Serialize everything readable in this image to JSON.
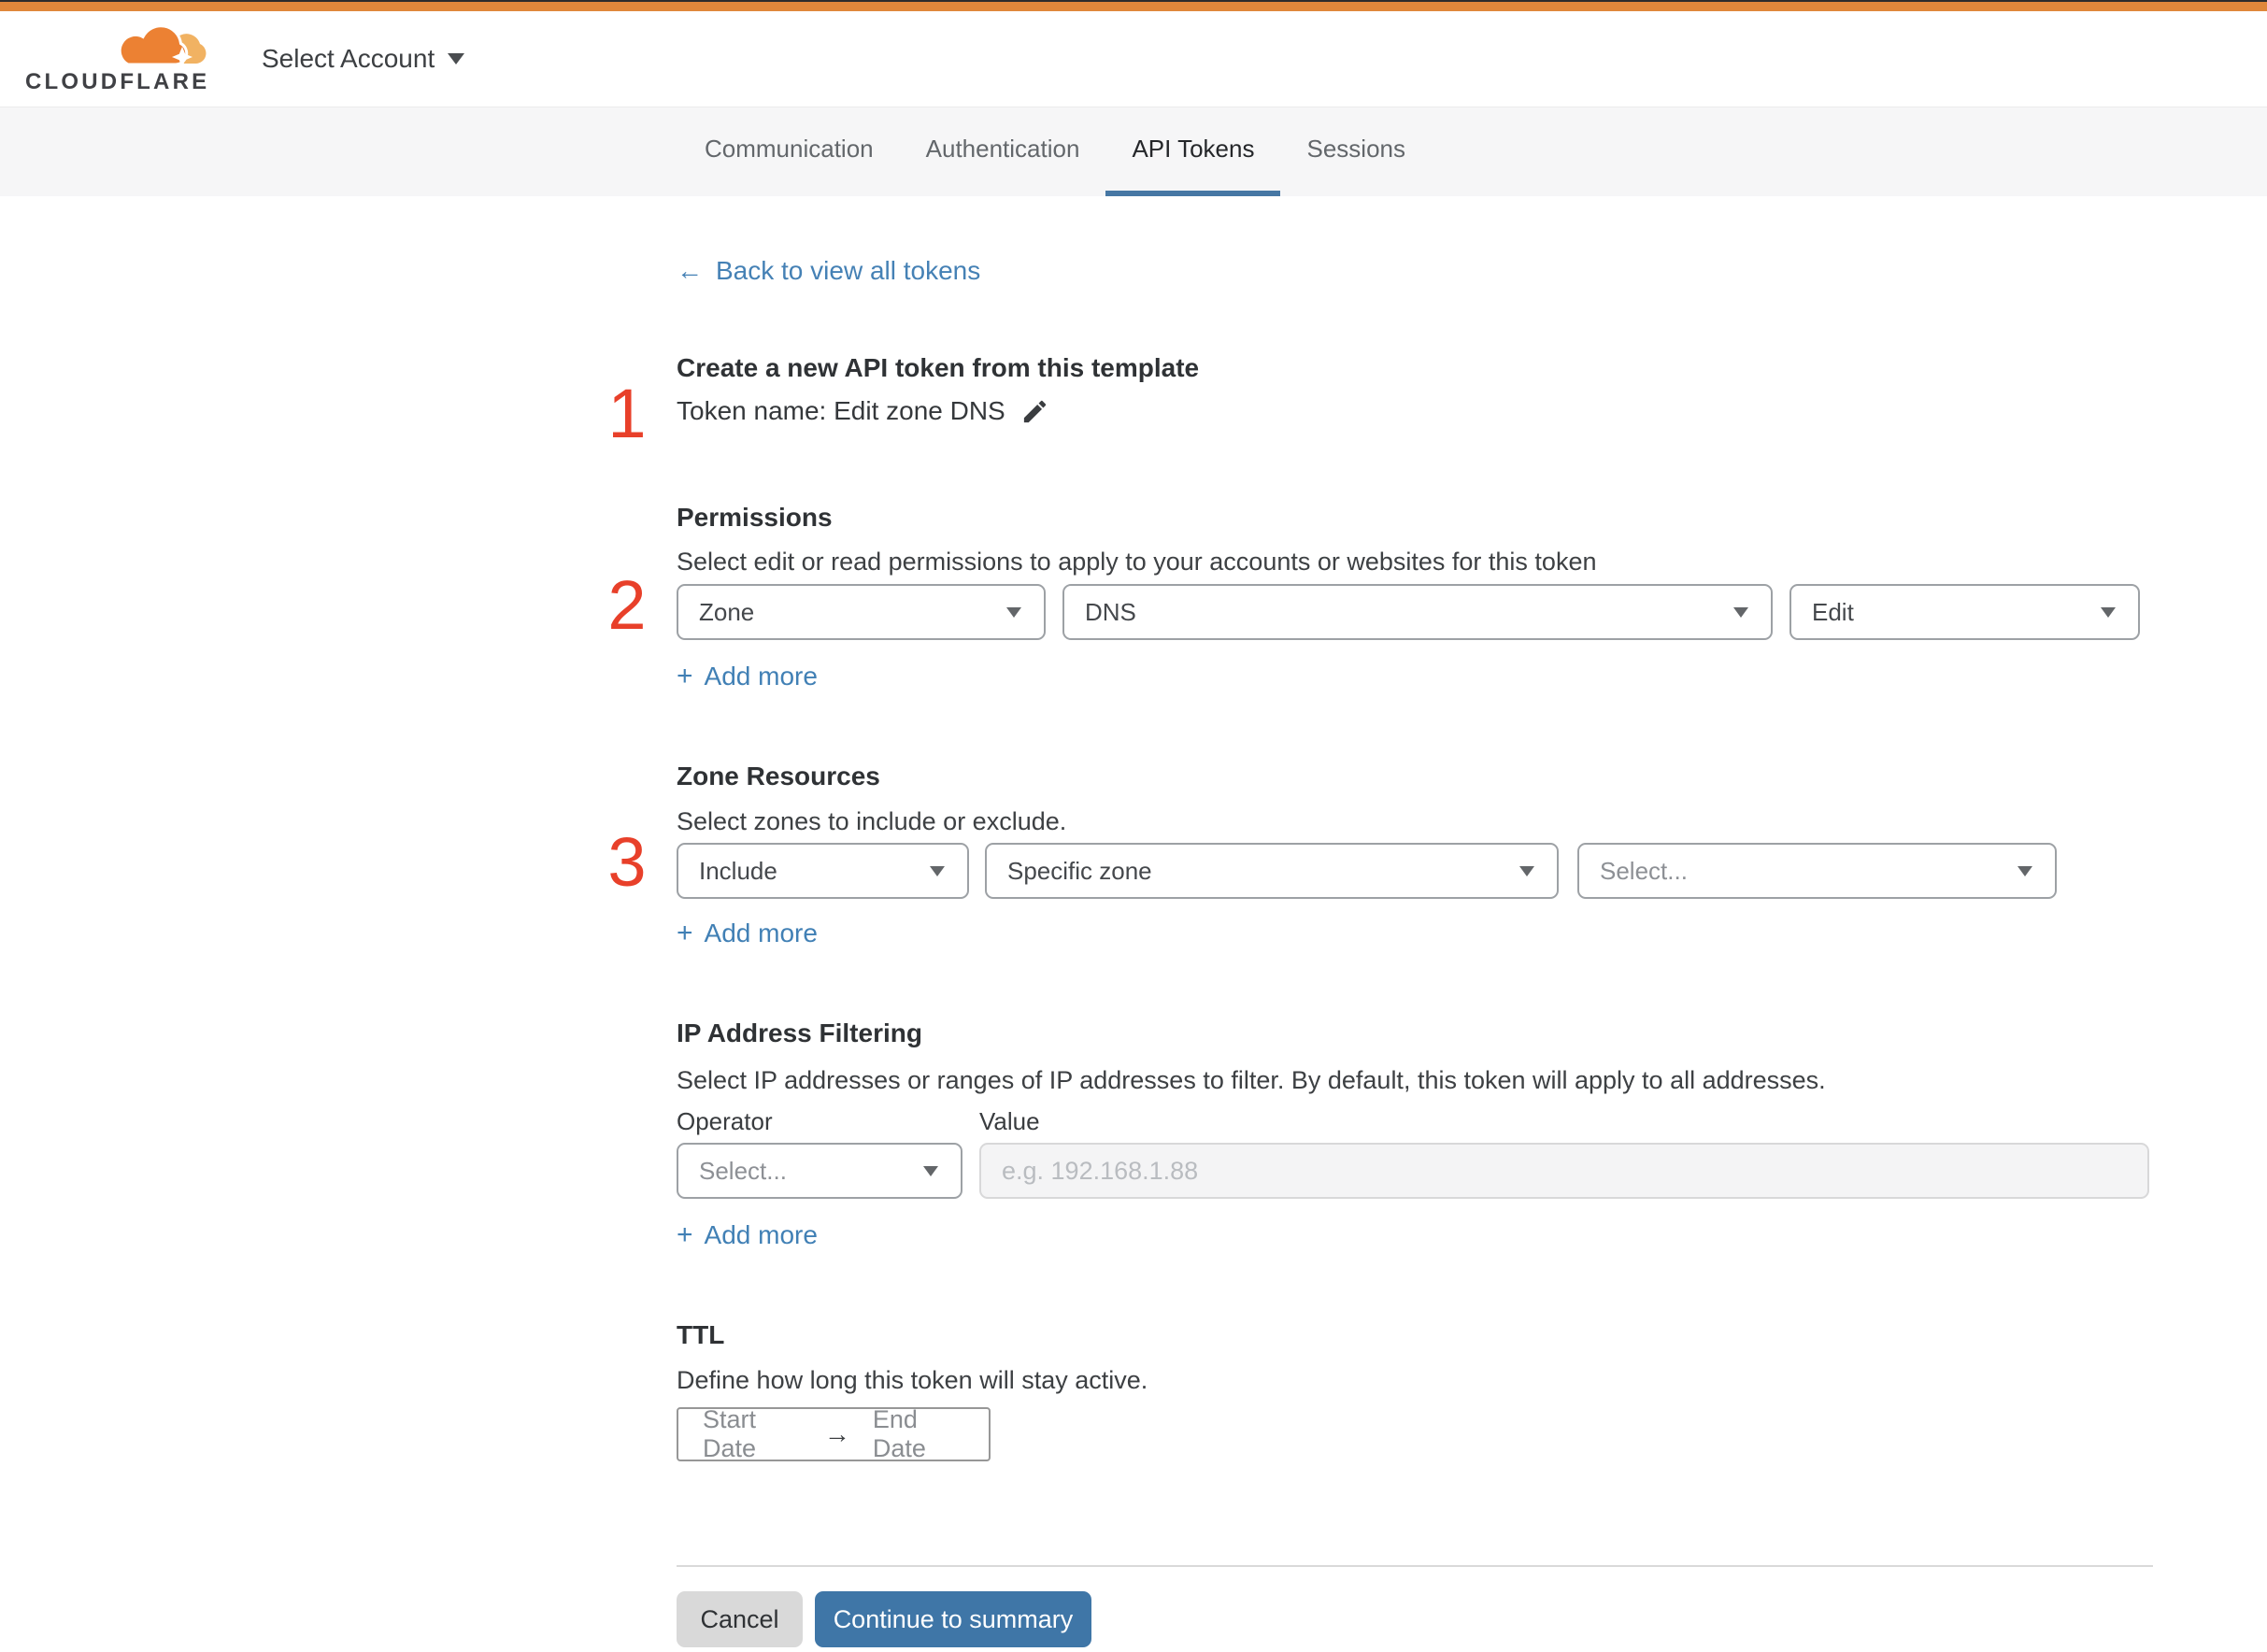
{
  "colors": {
    "top_bar_orange": "#e0883b",
    "brand_orange": "#ec8133",
    "brand_orange_light": "#f1b262",
    "accent_blue": "#3f76a7",
    "link_blue": "#4180b5",
    "step_red": "#e8402a"
  },
  "header": {
    "brand": "CLOUDFLARE",
    "account_selector": "Select Account"
  },
  "tabs": {
    "items": [
      {
        "label": "Communication"
      },
      {
        "label": "Authentication"
      },
      {
        "label": "API Tokens"
      },
      {
        "label": "Sessions"
      }
    ],
    "active": "API Tokens"
  },
  "icons": {
    "back_arrow": "←",
    "plus": "+",
    "range_arrow": "→"
  },
  "steps": [
    "1",
    "2",
    "3"
  ],
  "form": {
    "back_label": "Back to view all tokens",
    "title": "Create a new API token from this template",
    "token_name": "Token name: Edit zone DNS",
    "permissions": {
      "title": "Permissions",
      "description": "Select edit or read permissions to apply to your accounts or websites for this token",
      "scope": "Zone",
      "resource": "DNS",
      "access": "Edit",
      "add_more": "Add more"
    },
    "zone_resources": {
      "title": "Zone Resources",
      "description": "Select zones to include or exclude.",
      "operator": "Include",
      "scope_type": "Specific zone",
      "zone_placeholder": "Select...",
      "add_more": "Add more"
    },
    "ip_filtering": {
      "title": "IP Address Filtering",
      "description": "Select IP addresses or ranges of IP addresses to filter. By default, this token will apply to all addresses.",
      "operator_label": "Operator",
      "value_label": "Value",
      "operator_placeholder": "Select...",
      "value_placeholder": "e.g. 192.168.1.88",
      "add_more": "Add more"
    },
    "ttl": {
      "title": "TTL",
      "description": "Define how long this token will stay active.",
      "start_label": "Start Date",
      "end_label": "End Date"
    },
    "actions": {
      "cancel": "Cancel",
      "continue": "Continue to summary"
    }
  }
}
